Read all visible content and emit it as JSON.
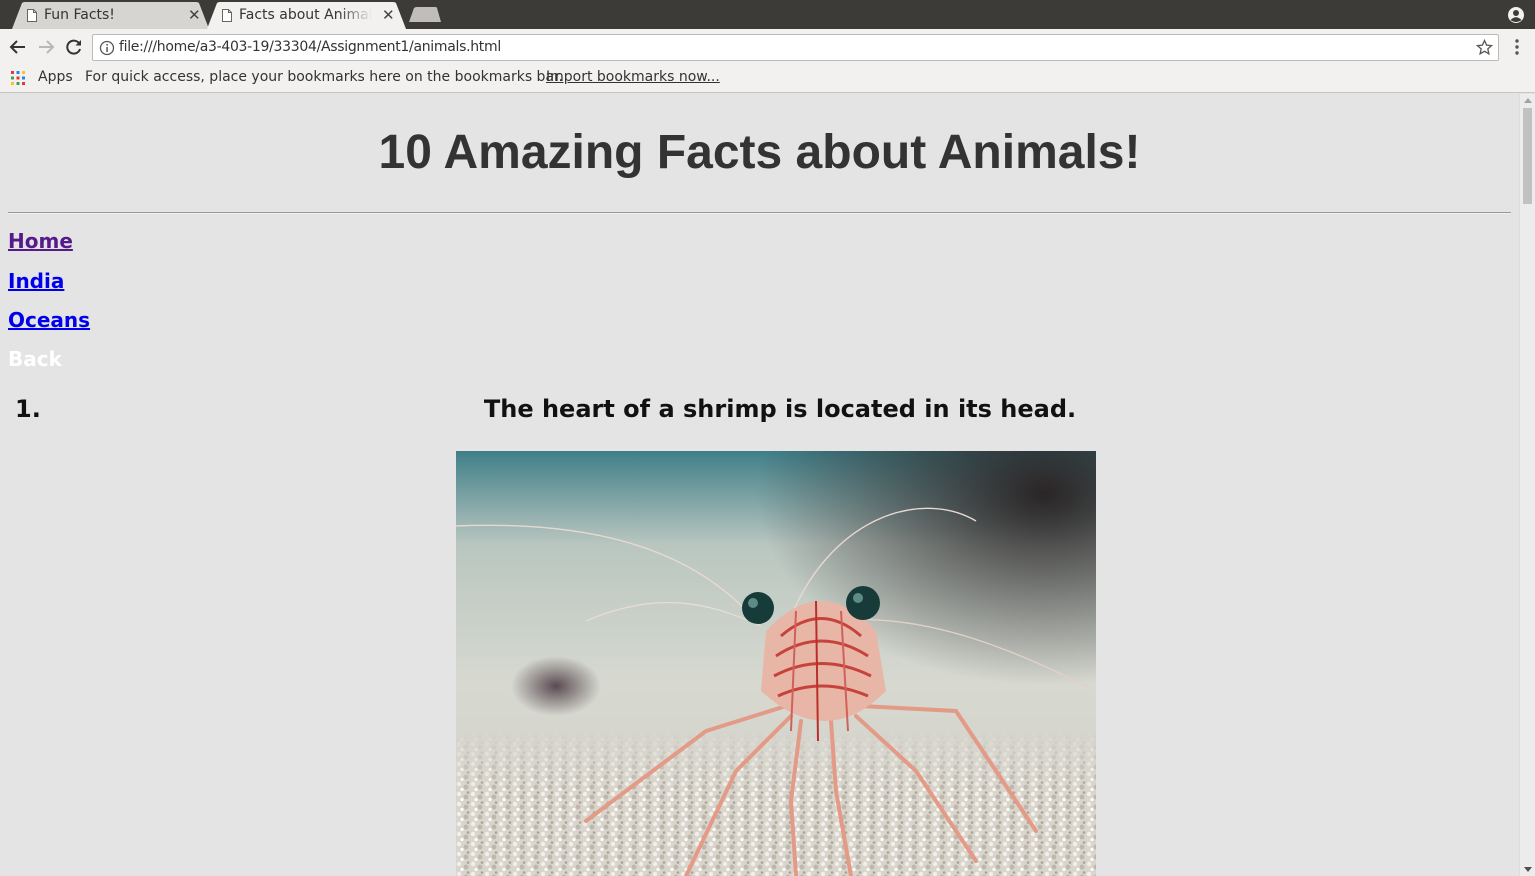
{
  "browser": {
    "tabs": [
      {
        "title": "Fun Facts!",
        "active": false
      },
      {
        "title": "Facts about Animals",
        "active": true
      }
    ],
    "address": "file:///home/a3-403-19/33304/Assignment1/animals.html",
    "bookmarks_bar": {
      "apps_label": "Apps",
      "hint": "For quick access, place your bookmarks here on the bookmarks bar.",
      "import_link": "Import bookmarks now..."
    }
  },
  "page": {
    "title": "10 Amazing Facts about Animals!",
    "nav": [
      {
        "label": "Home",
        "visited": true
      },
      {
        "label": "India",
        "visited": false
      },
      {
        "label": "Oceans",
        "visited": false
      },
      {
        "label": "Back",
        "visited": false
      }
    ],
    "facts": [
      {
        "number": "1.",
        "text": "The heart of a shrimp is located in its head.",
        "image": "shrimp-photo"
      }
    ]
  },
  "colors": {
    "page_background": "#e4e4e4",
    "title_text": "#333333",
    "link_unvisited": "#0000ee",
    "link_visited": "#551a8b",
    "back_link": "#ffffff"
  },
  "icons": [
    "document-icon",
    "close-icon",
    "new-tab-icon",
    "profile-icon",
    "back-arrow-icon",
    "forward-arrow-icon",
    "reload-icon",
    "info-icon",
    "bookmark-star-icon",
    "menu-icon",
    "apps-grid-icon"
  ]
}
